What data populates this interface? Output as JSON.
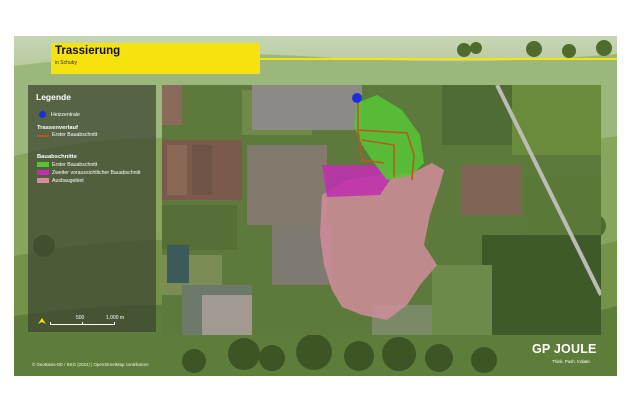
{
  "slide": {
    "title": "Trassierung",
    "subtitle": "in Schuby"
  },
  "legend": {
    "title": "Legende",
    "items": [
      {
        "label": "Heizzentrale",
        "symbol": "circle",
        "color": "#1a2fe0"
      },
      {
        "label": "Trassenverlauf",
        "symbol": "heading"
      },
      {
        "label": "Erster Bauabschnitt",
        "symbol": "line",
        "color": "#b85a1e"
      },
      {
        "label": "Bauabschnitte",
        "symbol": "heading"
      },
      {
        "label": "Erster Bauabschnitt",
        "symbol": "square",
        "color": "#58c235"
      },
      {
        "label": "Zweiter voraussichtlicher Bauabschnitt",
        "symbol": "square",
        "color": "#c02fb0"
      },
      {
        "label": "Ausbaugebiet",
        "symbol": "square",
        "color": "#d48e9e"
      }
    ]
  },
  "scale": {
    "tick1": "500",
    "tick2": "1.000 m"
  },
  "credits": "© GeoBasis-DE / BKG (2024) | OpenStreetMap contributors",
  "logo": {
    "wordmark": "GP JOULE",
    "tagline": "Think. Push. Initiate."
  },
  "map": {
    "layers": [
      {
        "name": "Heizzentrale",
        "color": "#1a2fe0"
      },
      {
        "name": "Erster Bauabschnitt",
        "color": "#58c235"
      },
      {
        "name": "Zweiter voraussichtlicher Bauabschnitt",
        "color": "#c02fb0"
      },
      {
        "name": "Ausbaugebiet",
        "color": "#d48e9e"
      },
      {
        "name": "Trassenverlauf",
        "color": "#b85a1e"
      }
    ]
  }
}
